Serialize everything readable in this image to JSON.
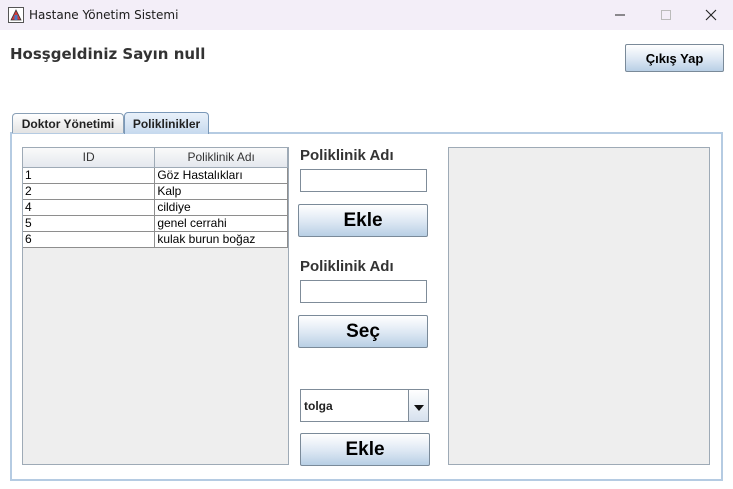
{
  "window": {
    "title": "Hastane Yönetim Sistemi",
    "controls": [
      "minimize-icon",
      "maximize-icon",
      "close-icon"
    ]
  },
  "header": {
    "welcome": "Hosşgeldiniz Sayın null",
    "logout_label": "Çıkış Yap"
  },
  "tabs": [
    {
      "label": "Doktor Yönetimi",
      "selected": false
    },
    {
      "label": "Poliklinikler",
      "selected": true
    }
  ],
  "table": {
    "columns": [
      "ID",
      "Poliklinik Adı"
    ],
    "rows": [
      [
        "1",
        "Göz Hastalıkları"
      ],
      [
        "2",
        "Kalp"
      ],
      [
        "4",
        "cildiye"
      ],
      [
        "5",
        "genel cerrahi"
      ],
      [
        "6",
        "kulak burun boğaz"
      ]
    ]
  },
  "form": {
    "add_label": "Poliklinik Adı",
    "add_value": "",
    "add_button": "Ekle",
    "select_label": "Poliklinik Adı",
    "select_value": "",
    "select_button": "Seç",
    "doctor_combo": "tolga",
    "assign_button": "Ekle"
  },
  "colors": {
    "titlebar": "#f3eef8",
    "tab_selected": "#c6d9ee",
    "panel_border": "#b5cbe2",
    "button_gradient_end": "#b8cfe5"
  }
}
